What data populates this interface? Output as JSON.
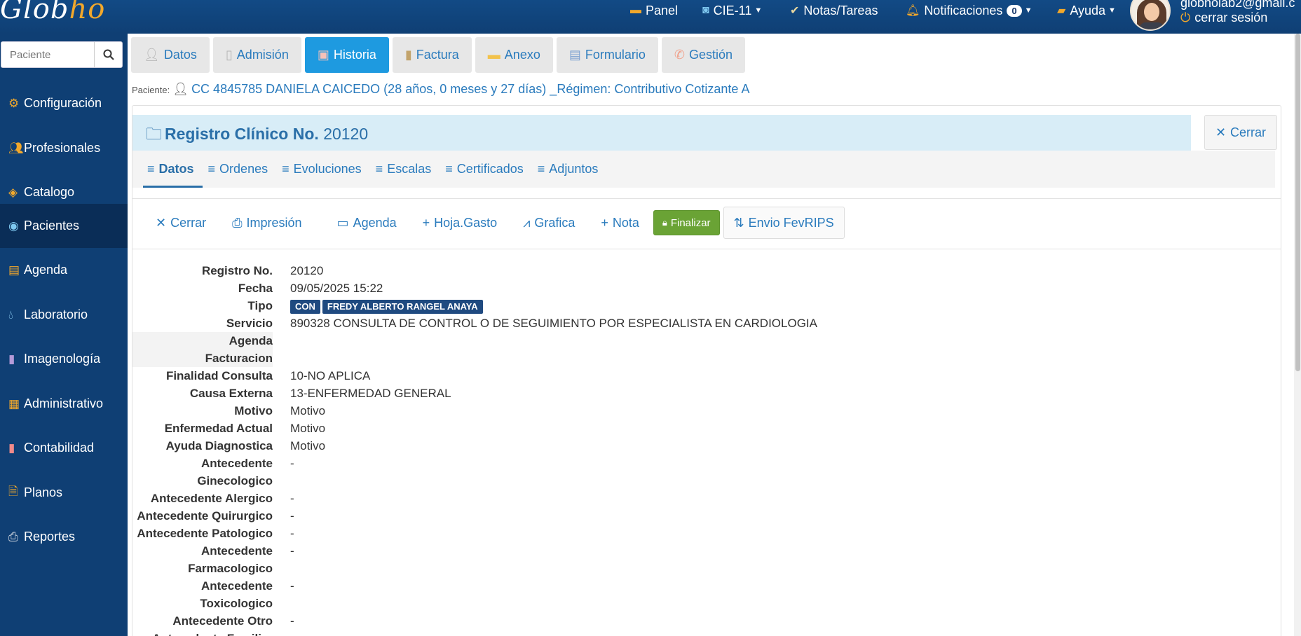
{
  "brand": {
    "logo_main": "Glob",
    "logo_accent": "ho"
  },
  "topnav": {
    "panel": "Panel",
    "cie": "CIE-11",
    "notas": "Notas/Tareas",
    "notificaciones": "Notificaciones",
    "notif_count": "0",
    "ayuda": "Ayuda",
    "user_email": "globholab2@gmail.c",
    "logout": "cerrar sesión"
  },
  "sidebar": {
    "search_placeholder": "Paciente",
    "items": [
      {
        "label": "Configuración",
        "icon": "gear-icon"
      },
      {
        "label": "Profesionales",
        "icon": "users-icon"
      },
      {
        "label": "Catalogo",
        "icon": "tags-icon"
      },
      {
        "label": "Pacientes",
        "icon": "user-circle-icon"
      },
      {
        "label": "Agenda",
        "icon": "calendar-icon"
      },
      {
        "label": "Laboratorio",
        "icon": "droplet-icon"
      },
      {
        "label": "Imagenología",
        "icon": "book-icon"
      },
      {
        "label": "Administrativo",
        "icon": "grid-icon"
      },
      {
        "label": "Contabilidad",
        "icon": "bookmark-icon"
      },
      {
        "label": "Planos",
        "icon": "file-zip-icon"
      },
      {
        "label": "Reportes",
        "icon": "printer-icon"
      }
    ],
    "active": "Pacientes"
  },
  "tabs": [
    {
      "label": "Datos"
    },
    {
      "label": "Admisión"
    },
    {
      "label": "Historia"
    },
    {
      "label": "Factura"
    },
    {
      "label": "Anexo"
    },
    {
      "label": "Formulario"
    },
    {
      "label": "Gestión"
    }
  ],
  "patient": {
    "label": "Paciente:",
    "info": "CC 4845785 DANIELA CAICEDO (28 años, 0 meses y 27 días) _Régimen: Contributivo Cotizante A"
  },
  "record": {
    "title_prefix": "Registro Clínico No.",
    "number": "20120",
    "close": "Cerrar"
  },
  "subtabs": [
    {
      "label": "Datos"
    },
    {
      "label": "Ordenes"
    },
    {
      "label": "Evoluciones"
    },
    {
      "label": "Escalas"
    },
    {
      "label": "Certificados"
    },
    {
      "label": "Adjuntos"
    }
  ],
  "toolbar": {
    "cerrar": "Cerrar",
    "impresion": "Impresión",
    "agenda": "Agenda",
    "hoja_gasto": "Hoja.Gasto",
    "grafica": "Grafica",
    "nota": "Nota",
    "finalizar": "Finalizar",
    "envio": "Envio FevRIPS"
  },
  "details": {
    "registro_label": "Registro No.",
    "registro": "20120",
    "fecha_label": "Fecha",
    "fecha": "09/05/2025 15:22",
    "tipo_label": "Tipo",
    "tipo_tag1": "CON",
    "tipo_tag2": "FREDY ALBERTO RANGEL ANAYA",
    "servicio_label": "Servicio",
    "servicio": "890328 CONSULTA DE CONTROL O DE SEGUIMIENTO POR ESPECIALISTA EN CARDIOLOGIA",
    "agenda_label": "Agenda",
    "agenda": "",
    "facturacion_label": "Facturacion",
    "facturacion": "",
    "finalidad_label": "Finalidad Consulta",
    "finalidad": "10-NO APLICA",
    "causa_label": "Causa Externa",
    "causa": "13-ENFERMEDAD GENERAL",
    "motivo_label": "Motivo",
    "motivo": "Motivo",
    "enfermedad_label": "Enfermedad Actual",
    "enfermedad": "Motivo",
    "ayuda_label": "Ayuda Diagnostica",
    "ayuda": "Motivo",
    "gineco_label1": "Antecedente",
    "gineco_label2": "Ginecologico",
    "gineco": "-",
    "alergico_label": "Antecedente Alergico",
    "alergico": "-",
    "quirurgico_label": "Antecedente Quirurgico",
    "quirurgico": "-",
    "patologico_label": "Antecedente Patologico",
    "patologico": "-",
    "farmaco_label1": "Antecedente",
    "farmaco_label2": "Farmacologico",
    "farmaco": "-",
    "toxico_label1": "Antecedente",
    "toxico_label2": "Toxicologico",
    "toxico": "-",
    "otro_label": "Antecedente Otro",
    "otro": "-",
    "familiar_label": "Antecedente Familiar"
  },
  "colors": {
    "primary": "#0f3f74",
    "accent": "#f2a82b",
    "link": "#2a7bbd",
    "active_tab": "#1e9ae0",
    "finalize": "#6aa335"
  }
}
